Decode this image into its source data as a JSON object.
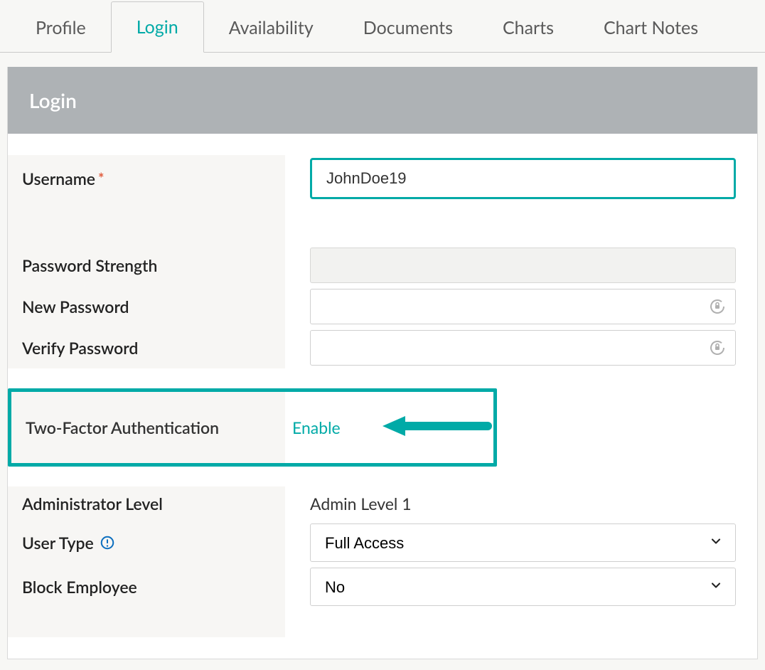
{
  "tabs": {
    "profile": "Profile",
    "login": "Login",
    "availability": "Availability",
    "documents": "Documents",
    "charts": "Charts",
    "chart_notes": "Chart Notes",
    "active": "login"
  },
  "panel": {
    "title": "Login"
  },
  "form": {
    "username_label": "Username",
    "username_value": "JohnDoe19",
    "password_strength_label": "Password Strength",
    "new_password_label": "New Password",
    "verify_password_label": "Verify Password",
    "tfa_label": "Two-Factor Authentication",
    "tfa_action": "Enable",
    "admin_level_label": "Administrator Level",
    "admin_level_value": "Admin Level 1",
    "user_type_label": "User Type",
    "user_type_value": "Full Access",
    "block_employee_label": "Block Employee",
    "block_employee_value": "No"
  }
}
